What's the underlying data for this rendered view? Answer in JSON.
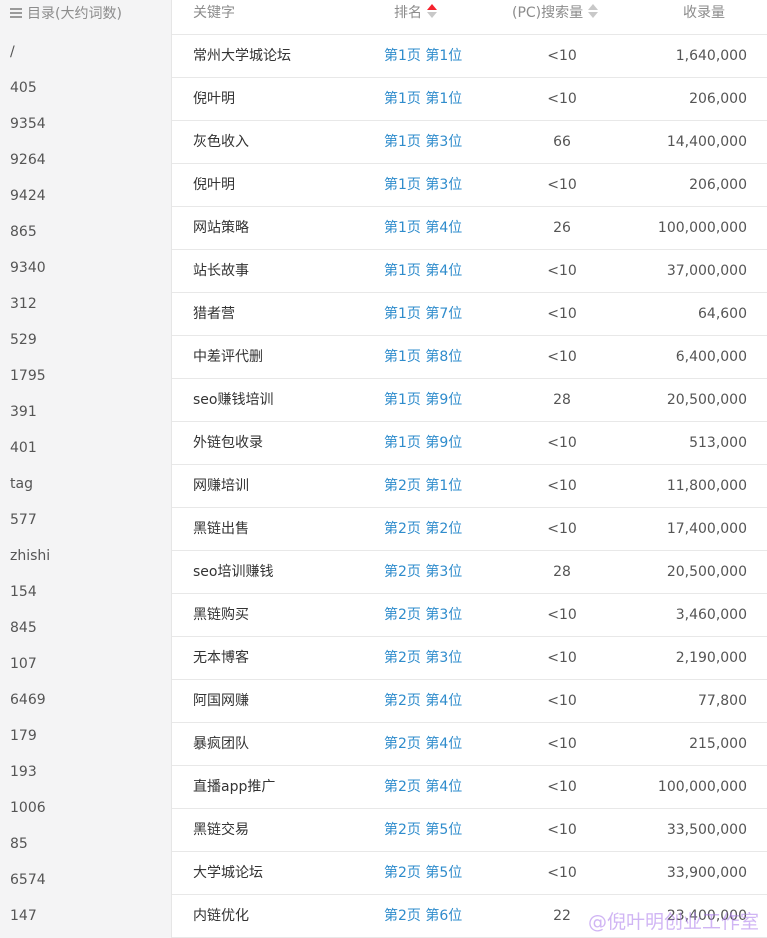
{
  "sidebar": {
    "header_label": "目录(大约词数)",
    "items": [
      "/",
      "405",
      "9354",
      "9264",
      "9424",
      "865",
      "9340",
      "312",
      "529",
      "1795",
      "391",
      "401",
      "tag",
      "577",
      "zhishi",
      "154",
      "845",
      "107",
      "6469",
      "179",
      "193",
      "1006",
      "85",
      "6574",
      "147"
    ]
  },
  "table": {
    "headers": {
      "keyword": "关键字",
      "rank": "排名",
      "search": "(PC)搜索量",
      "index": "收录量"
    },
    "rows": [
      {
        "keyword": "常州大学城论坛",
        "rank": "第1页 第1位",
        "search": "<10",
        "index": "1,640,000"
      },
      {
        "keyword": "倪叶明",
        "rank": "第1页 第1位",
        "search": "<10",
        "index": "206,000"
      },
      {
        "keyword": "灰色收入",
        "rank": "第1页 第3位",
        "search": "66",
        "index": "14,400,000"
      },
      {
        "keyword": "倪叶明",
        "rank": "第1页 第3位",
        "search": "<10",
        "index": "206,000"
      },
      {
        "keyword": "网站策略",
        "rank": "第1页 第4位",
        "search": "26",
        "index": "100,000,000"
      },
      {
        "keyword": "站长故事",
        "rank": "第1页 第4位",
        "search": "<10",
        "index": "37,000,000"
      },
      {
        "keyword": "猎者营",
        "rank": "第1页 第7位",
        "search": "<10",
        "index": "64,600"
      },
      {
        "keyword": "中差评代删",
        "rank": "第1页 第8位",
        "search": "<10",
        "index": "6,400,000"
      },
      {
        "keyword": "seo赚钱培训",
        "rank": "第1页 第9位",
        "search": "28",
        "index": "20,500,000"
      },
      {
        "keyword": "外链包收录",
        "rank": "第1页 第9位",
        "search": "<10",
        "index": "513,000"
      },
      {
        "keyword": "网赚培训",
        "rank": "第2页 第1位",
        "search": "<10",
        "index": "11,800,000"
      },
      {
        "keyword": "黑链出售",
        "rank": "第2页 第2位",
        "search": "<10",
        "index": "17,400,000"
      },
      {
        "keyword": "seo培训赚钱",
        "rank": "第2页 第3位",
        "search": "28",
        "index": "20,500,000"
      },
      {
        "keyword": "黑链购买",
        "rank": "第2页 第3位",
        "search": "<10",
        "index": "3,460,000"
      },
      {
        "keyword": "无本博客",
        "rank": "第2页 第3位",
        "search": "<10",
        "index": "2,190,000"
      },
      {
        "keyword": "阿国网赚",
        "rank": "第2页 第4位",
        "search": "<10",
        "index": "77,800"
      },
      {
        "keyword": "暴疯团队",
        "rank": "第2页 第4位",
        "search": "<10",
        "index": "215,000"
      },
      {
        "keyword": "直播app推广",
        "rank": "第2页 第4位",
        "search": "<10",
        "index": "100,000,000"
      },
      {
        "keyword": "黑链交易",
        "rank": "第2页 第5位",
        "search": "<10",
        "index": "33,500,000"
      },
      {
        "keyword": "大学城论坛",
        "rank": "第2页 第5位",
        "search": "<10",
        "index": "33,900,000"
      },
      {
        "keyword": "内链优化",
        "rank": "第2页 第6位",
        "search": "22",
        "index": "23,400,000"
      }
    ]
  },
  "watermark": "@倪叶明创业工作室",
  "colors": {
    "link": "#2f8ccc",
    "sort_active": "#f5222d",
    "sort_inactive": "#c8c8c8",
    "sidebar_bg": "#f4f4f5",
    "border": "#e8e8e8"
  }
}
